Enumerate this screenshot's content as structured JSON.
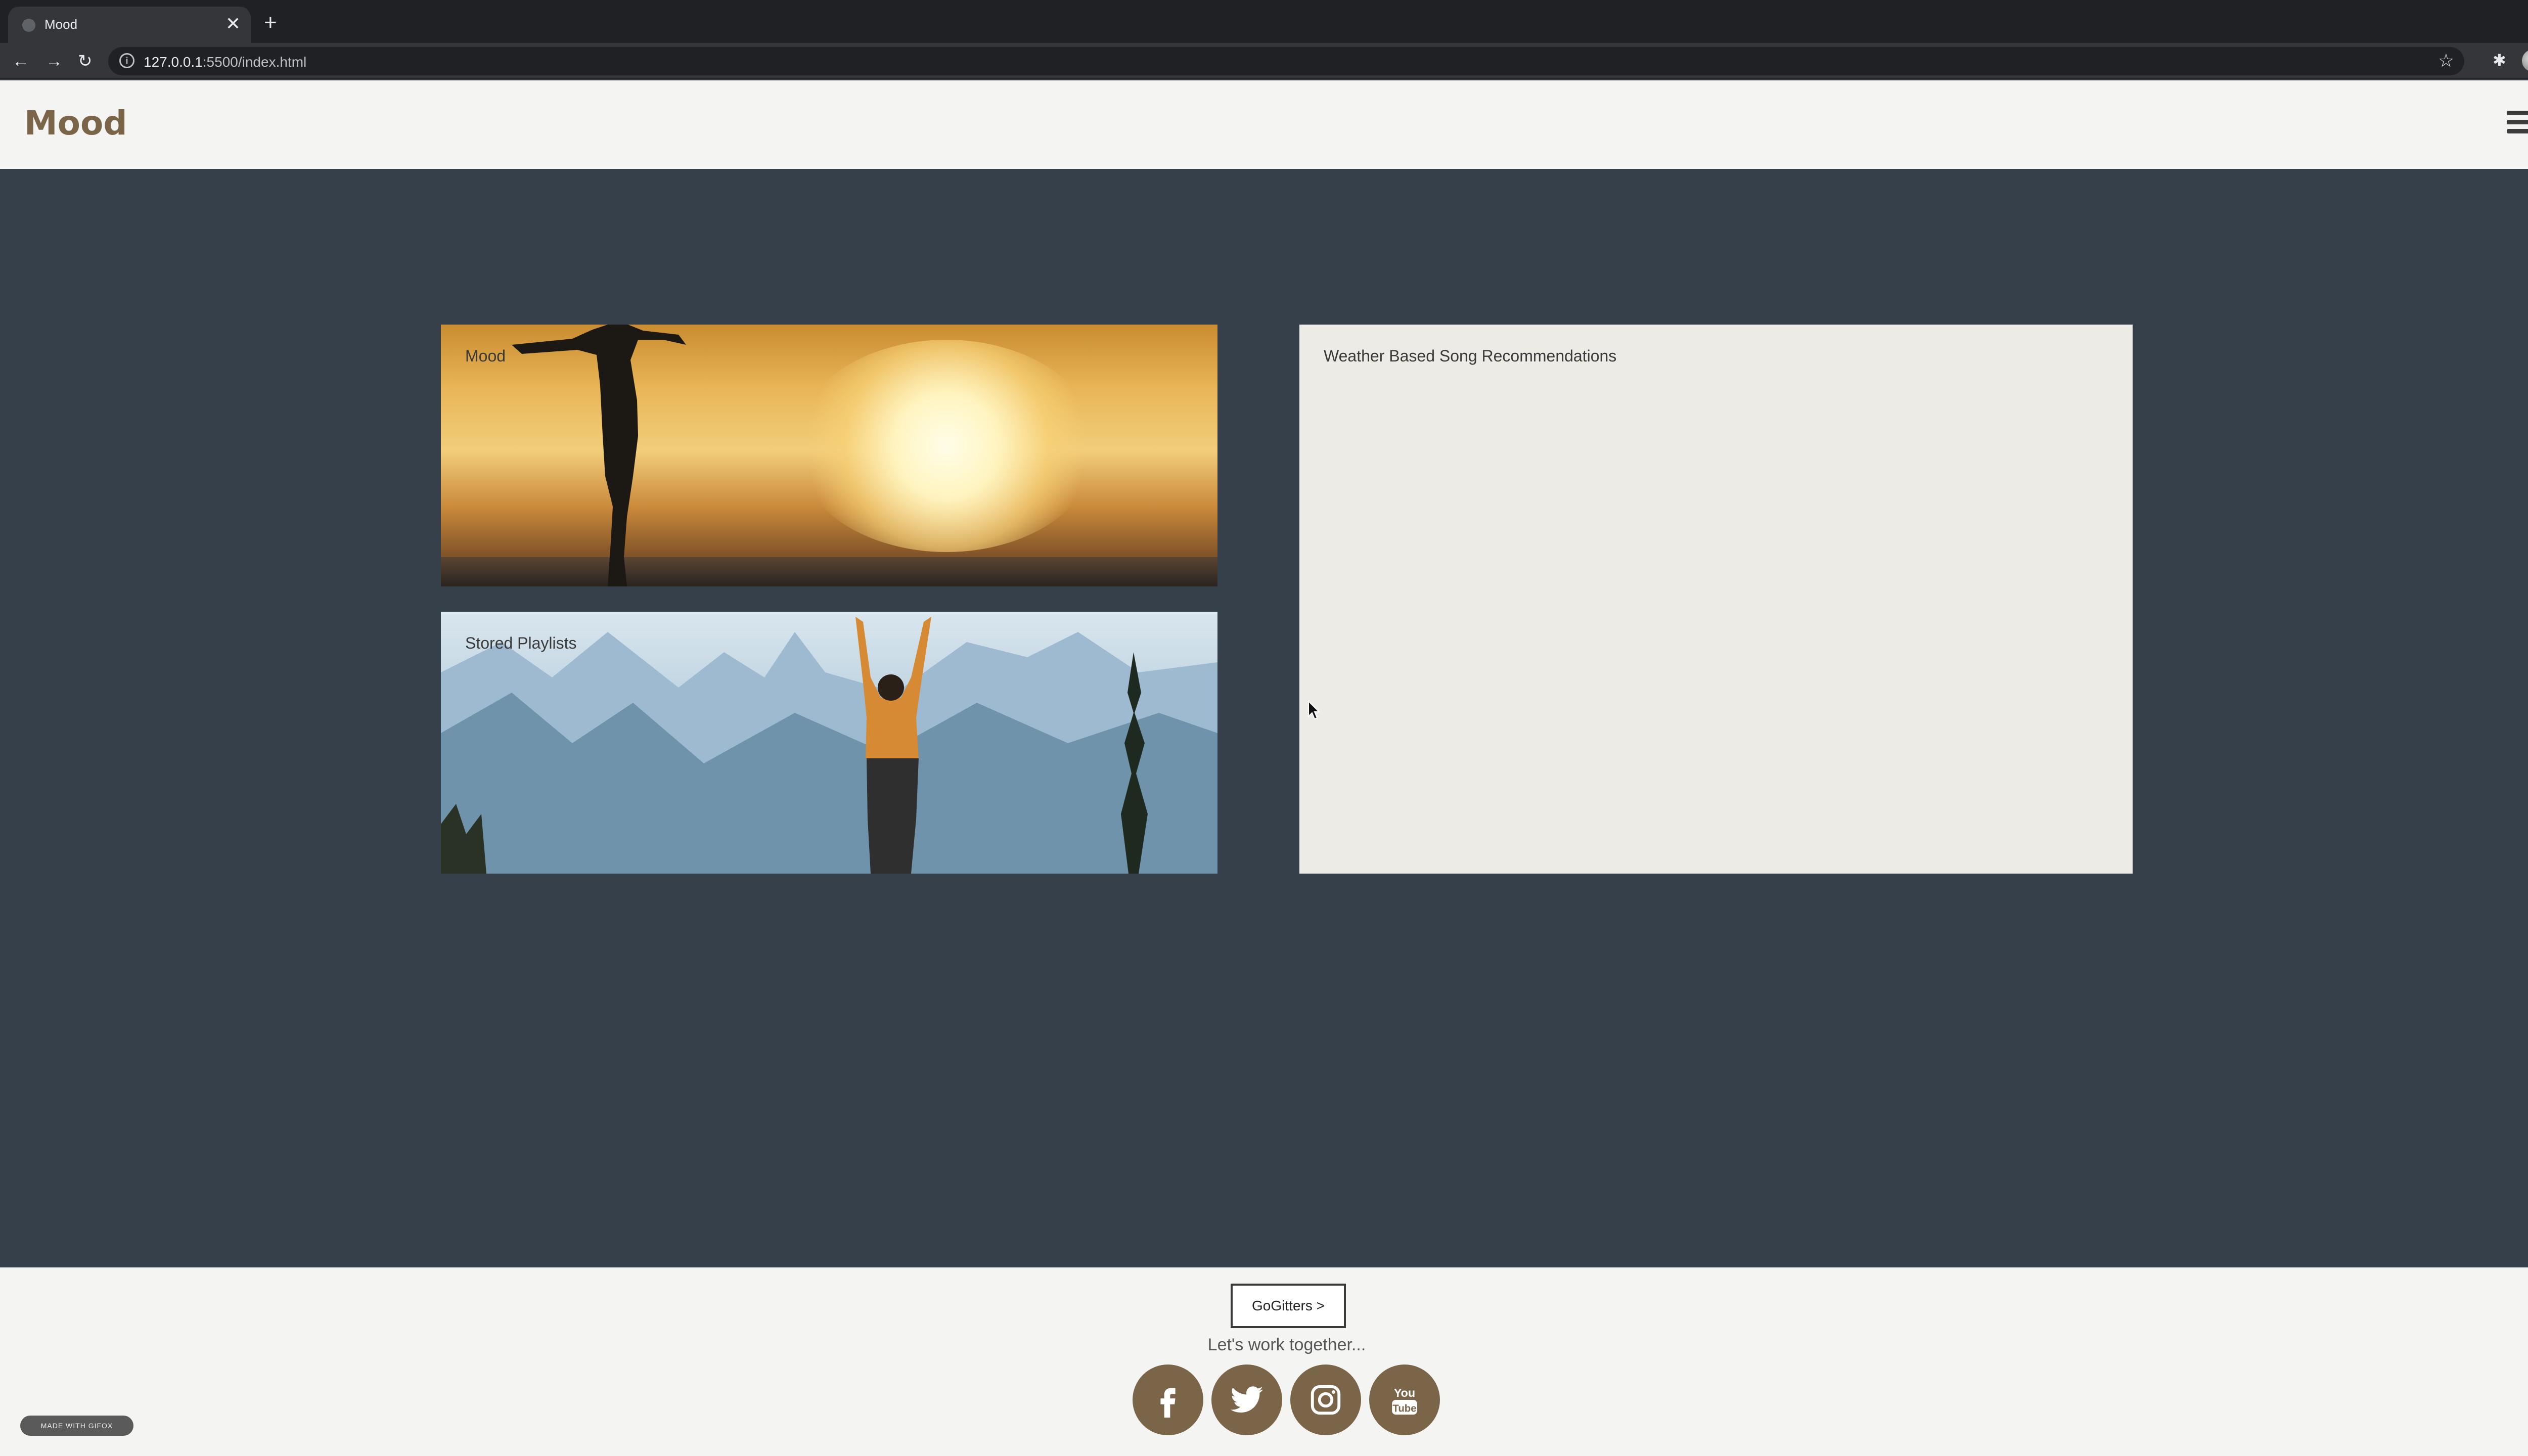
{
  "browser": {
    "tab_title": "Mood",
    "close_glyph": "✕",
    "new_tab_glyph": "+",
    "back_glyph": "←",
    "forward_glyph": "→",
    "reload_glyph": "↻",
    "url_host": "127.0.0.1",
    "url_rest": ":5500/index.html",
    "star_glyph": "☆",
    "extensions_glyph": "✱",
    "menu_glyph": "⋮",
    "info_glyph": "i"
  },
  "header": {
    "logo": "Mood"
  },
  "cards": {
    "mood_label": "Mood",
    "playlists_label": "Stored Playlists",
    "weather_label": "Weather Based Song Recommendations"
  },
  "footer": {
    "button_label": "GoGitters >",
    "tagline": "Let's work together...",
    "social": [
      "facebook-icon",
      "twitter-icon",
      "instagram-icon",
      "youtube-icon"
    ],
    "badge": "MADE WITH GIFOX"
  },
  "colors": {
    "brand": "#7a6549",
    "background": "#35404b",
    "panel": "#ecebe6"
  }
}
